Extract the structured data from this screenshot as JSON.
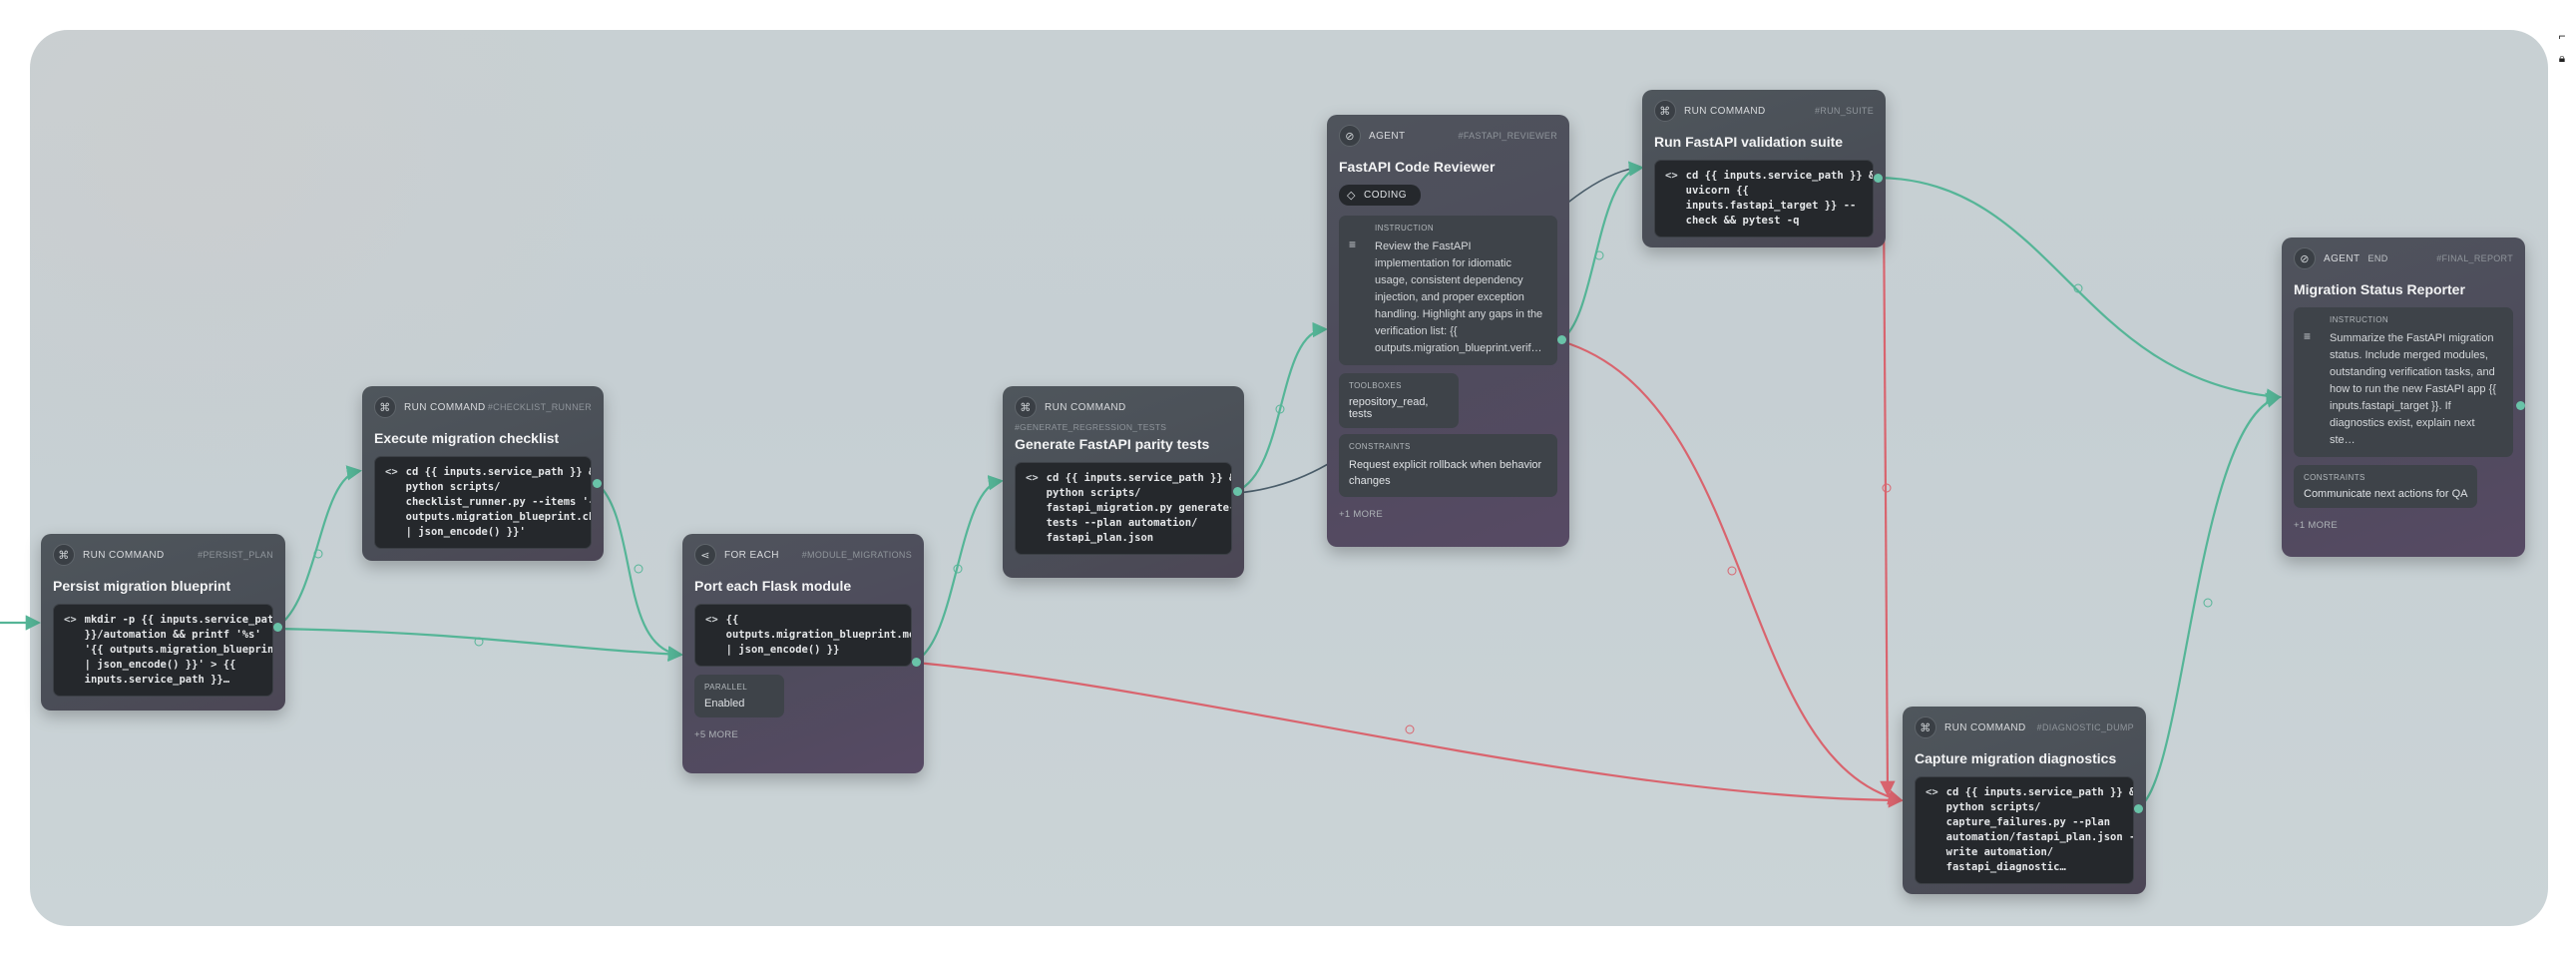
{
  "nodes": {
    "persist": {
      "type": "RUN COMMAND",
      "id_label": "#PERSIST_PLAN",
      "title": "Persist migration blueprint",
      "code": "mkdir -p {{ inputs.service_path\n}}/automation && printf '%s'\n'{{ outputs.migration_blueprint\n| json_encode() }}' > {{\ninputs.service_path }}…"
    },
    "checklist": {
      "type": "RUN COMMAND",
      "id_label": "#CHECKLIST_RUNNER",
      "title": "Execute migration checklist",
      "code": "cd {{ inputs.service_path }} &&\npython scripts/\nchecklist_runner.py --items '{{\noutputs.migration_blueprint.checkl\n| json_encode() }}'"
    },
    "foreach": {
      "type": "FOR EACH",
      "id_label": "#MODULE_MIGRATIONS",
      "title": "Port each Flask module",
      "code": "{{\noutputs.migration_blueprint.modules\n| json_encode() }}",
      "parallel_label": "PARALLEL",
      "parallel_value": "Enabled",
      "more": "+5 MORE"
    },
    "parity": {
      "type": "RUN COMMAND",
      "id_label": "#GENERATE_REGRESSION_TESTS",
      "title": "Generate FastAPI parity tests",
      "code": "cd {{ inputs.service_path }} &&\npython scripts/\nfastapi_migration.py generate-\ntests --plan automation/\nfastapi_plan.json"
    },
    "reviewer": {
      "type": "AGENT",
      "id_label": "#FASTAPI_REVIEWER",
      "title": "FastAPI Code Reviewer",
      "tag": "CODING",
      "instruction_label": "INSTRUCTION",
      "instruction": "Review the FastAPI implementation for idiomatic usage, consistent dependency injection, and proper exception handling. Highlight any gaps in the verification list: {{ outputs.migration_blueprint.verif…",
      "tools_label": "TOOLBOXES",
      "tools_value": "repository_read, tests",
      "constraints_label": "CONSTRAINTS",
      "constraints_value": "Request explicit rollback when behavior changes",
      "more": "+1 MORE"
    },
    "validation": {
      "type": "RUN COMMAND",
      "id_label": "#RUN_SUITE",
      "title": "Run FastAPI validation suite",
      "code": "cd {{ inputs.service_path }} &&\nuvicorn {{\ninputs.fastapi_target }} --\ncheck && pytest -q"
    },
    "diagnostics": {
      "type": "RUN COMMAND",
      "id_label": "#DIAGNOSTIC_DUMP",
      "title": "Capture migration diagnostics",
      "code": "cd {{ inputs.service_path }} &&\npython scripts/\ncapture_failures.py --plan\nautomation/fastapi_plan.json --\nwrite automation/\nfastapi_diagnostic…"
    },
    "reporter": {
      "type": "AGENT",
      "badge": "END",
      "id_label": "#FINAL_REPORT",
      "title": "Migration Status Reporter",
      "instruction_label": "INSTRUCTION",
      "instruction": "Summarize the FastAPI migration status. Include merged modules, outstanding verification tasks, and how to run the new FastAPI app {{ inputs.fastapi_target }}. If diagnostics exist, explain next ste…",
      "constraints_label": "CONSTRAINTS",
      "constraints_value": "Communicate next actions for QA",
      "more": "+1 MORE"
    }
  },
  "icons": {
    "run_command": "terminal-icon",
    "for_each": "share-icon",
    "agent": "compass-icon",
    "code": "code-icon",
    "tag": "tag-icon",
    "instruction": "lines-icon"
  },
  "colors": {
    "success_edge": "#55b597",
    "failure_edge": "#d9646e",
    "node_bg": "#4d535a",
    "code_bg": "#25282c"
  }
}
